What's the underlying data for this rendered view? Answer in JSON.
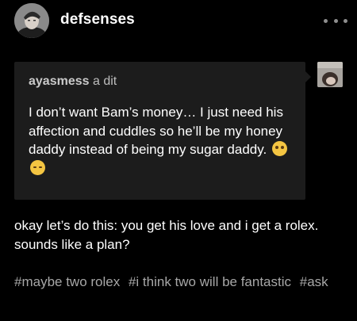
{
  "header": {
    "username": "defsenses",
    "more_icon": "more-horizontal-icon"
  },
  "ask": {
    "asker_name": "ayasmess",
    "asker_verb": "a dit",
    "text": "I don’t want Bam’s money… I just need his affection and cuddles so he’ll be my honey daddy instead of being my sugar daddy.",
    "emojis": [
      "pleading-face-emoji",
      "pensive-face-emoji"
    ]
  },
  "answer": {
    "text": "okay let’s do this: you get his love and i get a rolex. sounds like a plan?"
  },
  "tags": [
    "#maybe two rolex",
    "#i think two will be fantastic",
    "#ask"
  ],
  "colors": {
    "background": "#000000",
    "ask_bubble": "#1c1c1c",
    "text": "#ffffff",
    "muted_text": "#a7a7a7"
  }
}
